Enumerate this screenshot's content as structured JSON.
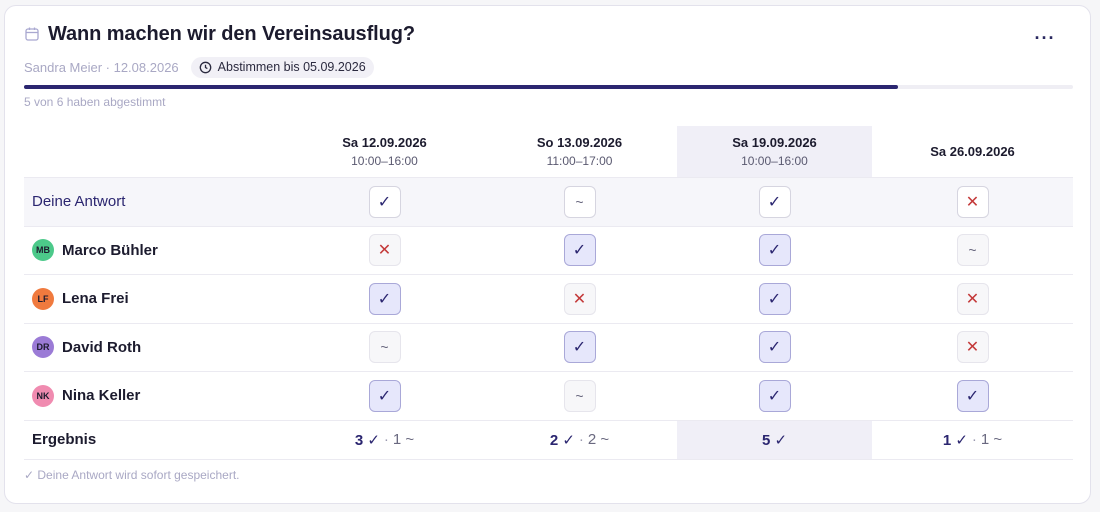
{
  "poll": {
    "title": "Wann machen wir den Vereinsausflug?",
    "meta": "Sandra Meier · 12.08.2026",
    "deadline": "Abstimmen bis 05.09.2026",
    "more_label": "···",
    "progress_fraction": 0.833,
    "progress_text": "5 von 6 haben abgestimmt"
  },
  "dates": [
    {
      "date": "Sa 12.09.2026",
      "time": "10:00–16:00"
    },
    {
      "date": "So 13.09.2026",
      "time": "11:00–17:00"
    },
    {
      "date": "Sa 19.09.2026",
      "time": "10:00–16:00"
    },
    {
      "date": "Sa 26.09.2026",
      "time": ""
    }
  ],
  "highlight_column": 2,
  "my_answer": {
    "label": "Deine Antwort",
    "votes": [
      "yes",
      "maybe",
      "yes",
      "no"
    ]
  },
  "participants": [
    {
      "initials": "MB",
      "name": "Marco Bühler",
      "color": "#4cc98a",
      "votes": [
        "no",
        "yes",
        "yes",
        "maybe"
      ]
    },
    {
      "initials": "LF",
      "name": "Lena Frei",
      "color": "#f07a3e",
      "votes": [
        "yes",
        "no",
        "yes",
        "no"
      ]
    },
    {
      "initials": "DR",
      "name": "David Roth",
      "color": "#9b7bd6",
      "votes": [
        "maybe",
        "yes",
        "yes",
        "no"
      ]
    },
    {
      "initials": "NK",
      "name": "Nina Keller",
      "color": "#f08bb0",
      "votes": [
        "yes",
        "maybe",
        "yes",
        "yes"
      ]
    }
  ],
  "result": {
    "label": "Ergebnis",
    "cols": [
      {
        "yes": "3 ✓",
        "maybe": "1 ~"
      },
      {
        "yes": "2 ✓",
        "maybe": "2 ~"
      },
      {
        "yes": "5 ✓",
        "maybe": ""
      },
      {
        "yes": "1 ✓",
        "maybe": "1 ~"
      }
    ]
  },
  "symbols": {
    "yes": "✓",
    "no": "✕",
    "maybe": "~"
  },
  "footer": "✓ Deine Antwort wird sofort gespeichert."
}
